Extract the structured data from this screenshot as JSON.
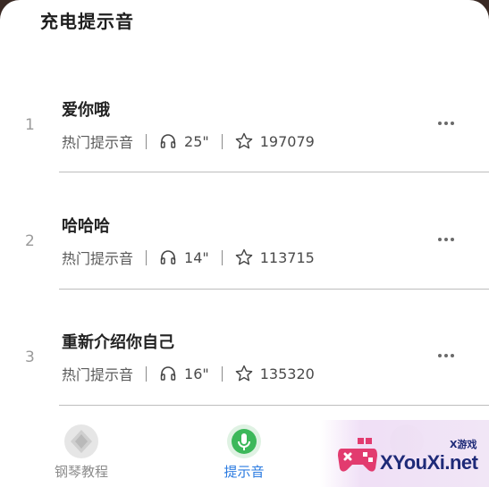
{
  "header": {
    "title": "充电提示音"
  },
  "items": [
    {
      "index": "1",
      "name": "爱你哦",
      "category": "热门提示音",
      "duration": "25\"",
      "stars": "197079"
    },
    {
      "index": "2",
      "name": "哈哈哈",
      "category": "热门提示音",
      "duration": "14\"",
      "stars": "113715"
    },
    {
      "index": "3",
      "name": "重新介绍你自己",
      "category": "热门提示音",
      "duration": "16\"",
      "stars": "135320"
    }
  ],
  "tabbar": {
    "tabs": [
      {
        "label": "钢琴教程",
        "icon": "piano-tab-icon"
      },
      {
        "label": "提示音",
        "icon": "ringtone-tab-icon",
        "active": true
      },
      {
        "label": "",
        "icon": "third-tab-icon"
      }
    ]
  },
  "watermark": {
    "brand": "XYouXi.net",
    "tag": "X游戏"
  },
  "colors": {
    "accent": "#2b7be0",
    "active_icon": "#3cb85a"
  }
}
